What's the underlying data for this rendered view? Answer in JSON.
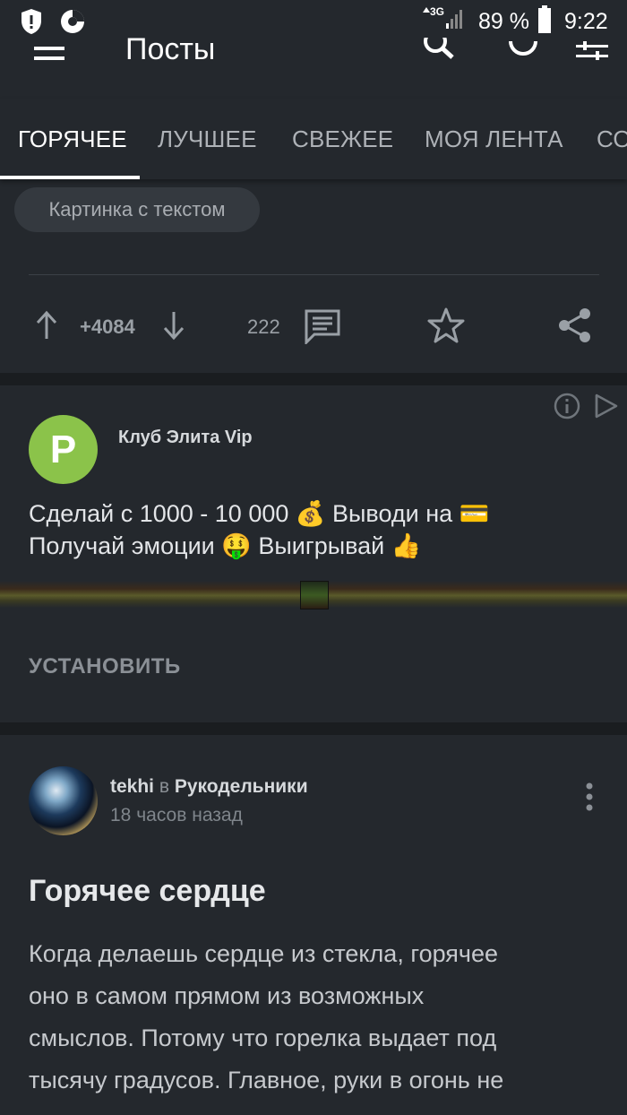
{
  "status_bar": {
    "network": "3G",
    "battery_percent": "89 %",
    "time": "9:22",
    "battery_level": 0.89
  },
  "toolbar": {
    "title": "Посты",
    "menu_icon": "hamburger-menu-icon",
    "search_icon": "search-icon",
    "refresh_icon": "refresh-icon",
    "filter_icon": "filter-sliders-icon"
  },
  "tabs": [
    {
      "label": "ГОРЯЧЕЕ",
      "active": true
    },
    {
      "label": "ЛУЧШЕЕ",
      "active": false
    },
    {
      "label": "СВЕЖЕЕ",
      "active": false
    },
    {
      "label": "МОЯ ЛЕНТА",
      "active": false
    },
    {
      "label": "СО",
      "active": false
    }
  ],
  "first_post": {
    "tag": "Картинка с текстом",
    "rating": "+4084",
    "comments": "222"
  },
  "ad": {
    "avatar_letter": "P",
    "avatar_color": "#8bc34a",
    "title": "Клуб Элита Vip",
    "text_line1": "Сделай с 1000 - 10 000  💰 Выводи на 💳",
    "text_line2": "Получай эмоции 🤑 Выигрывай 👍",
    "install_label": "УСТАНОВИТЬ"
  },
  "second_post": {
    "author": "tekhi",
    "in_word": "в",
    "community": "Рукодельники",
    "time": "18 часов назад",
    "title": "Горячее сердце",
    "body_lines": [
      "Когда делаешь сердце из стекла, горячее",
      "оно в самом прямом из возможных",
      "смыслов. Потому что горелка выдает под",
      "тысячу градусов. Главное, руки в огонь не"
    ]
  },
  "colors": {
    "background": "#24282d",
    "separator": "#1a1d20",
    "accent_white": "#ffffff"
  }
}
